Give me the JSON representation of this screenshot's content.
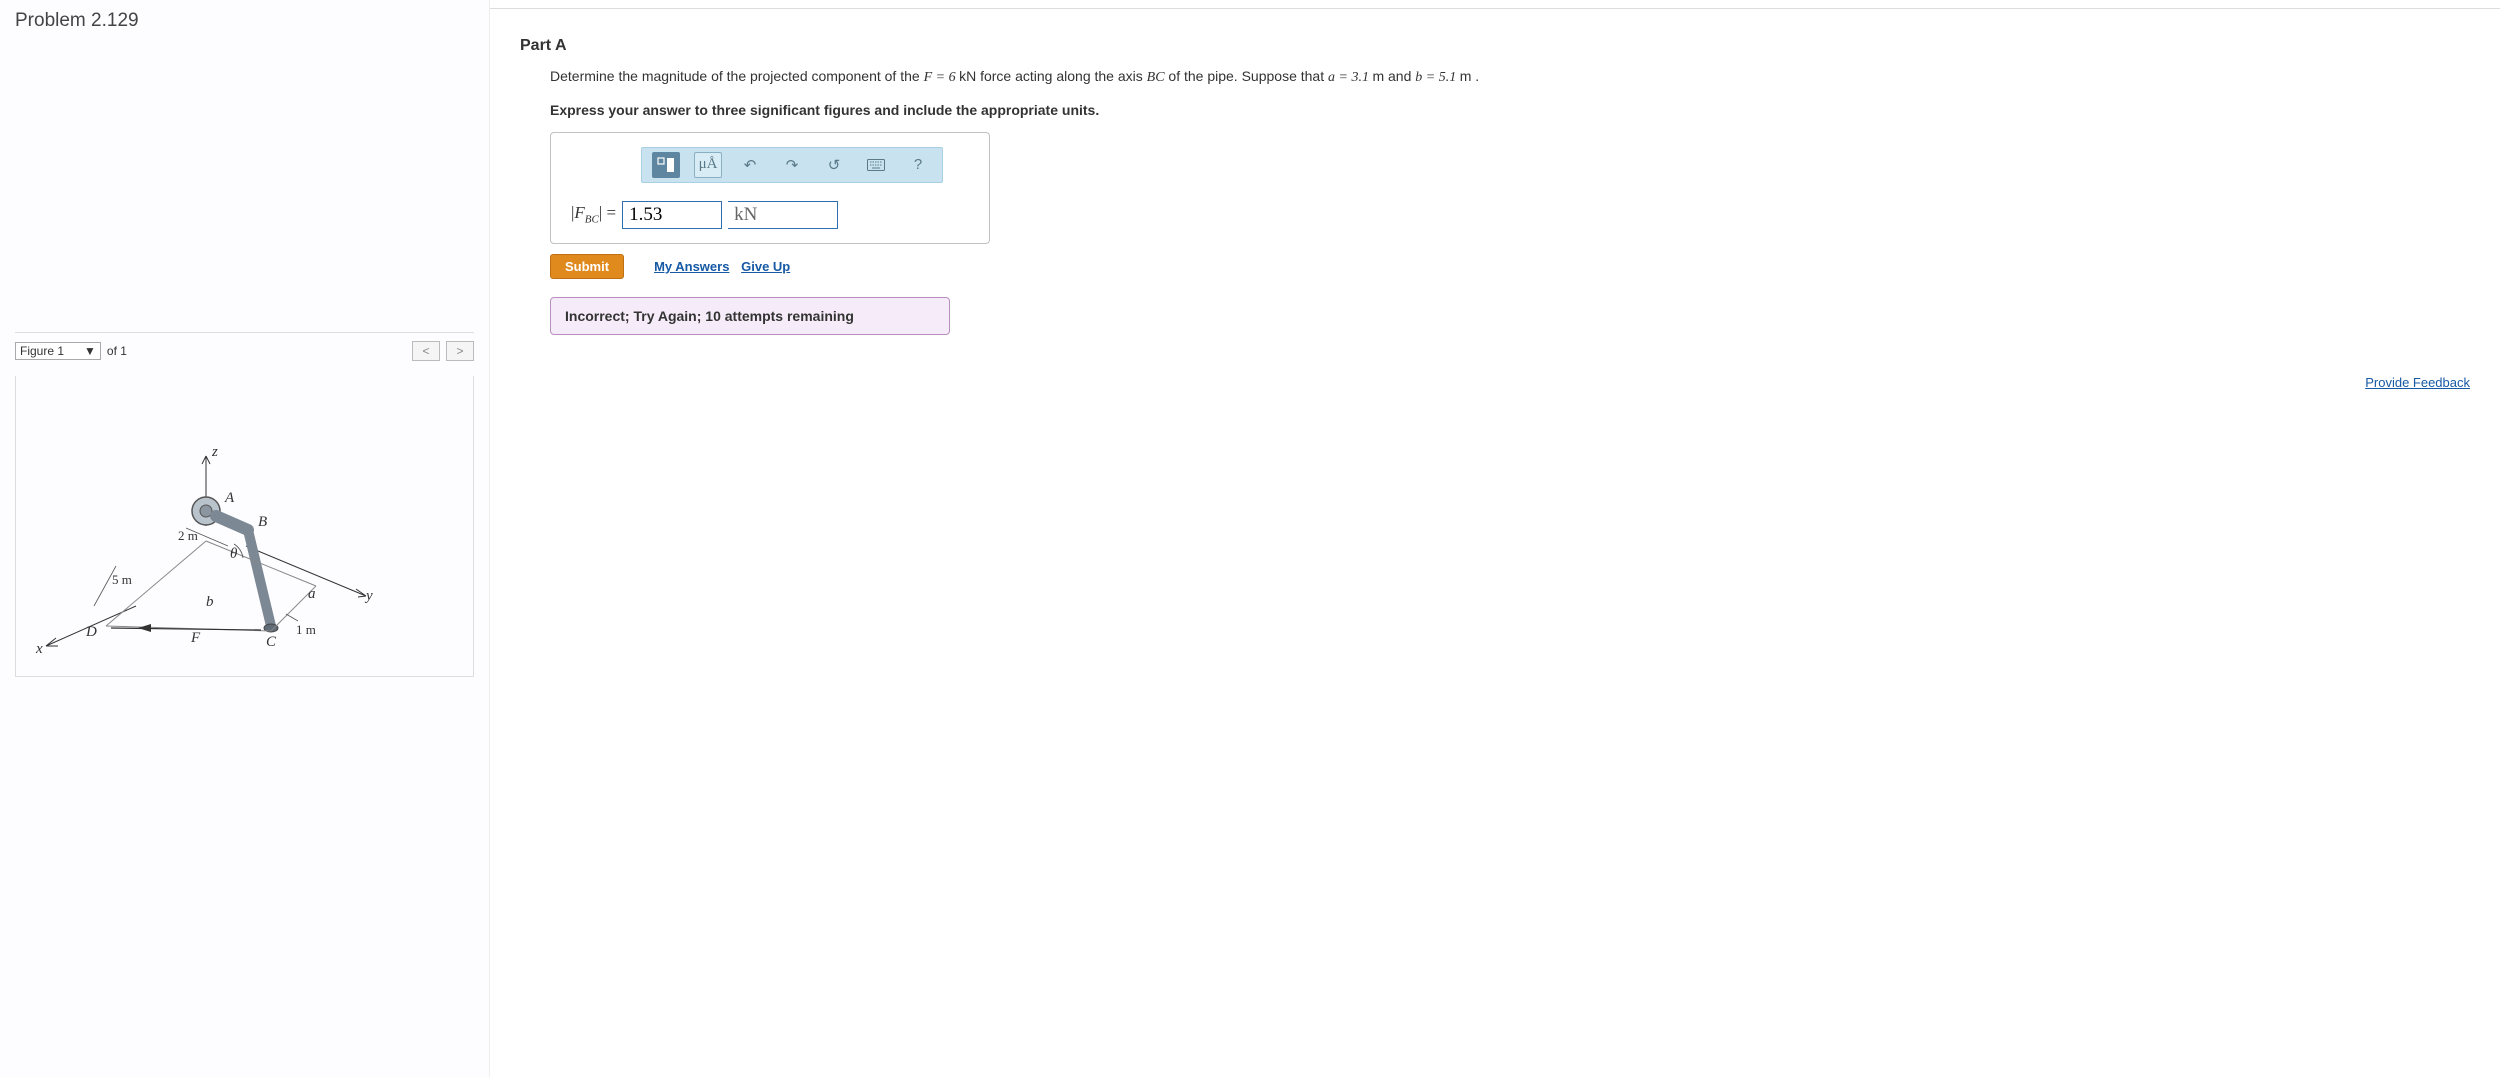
{
  "problem": {
    "title": "Problem 2.129"
  },
  "figure": {
    "selector_label": "Figure 1",
    "of_label": "of 1",
    "labels": {
      "z": "z",
      "y": "y",
      "x": "x",
      "A": "A",
      "B": "B",
      "C": "C",
      "D": "D",
      "F": "F",
      "theta": "θ",
      "a": "a",
      "b": "b"
    },
    "dims": {
      "two_m": "2 m",
      "five_m": "5 m",
      "one_m": "1 m"
    }
  },
  "part": {
    "heading": "Part A",
    "prompt_pre": "Determine the magnitude of the projected component of the ",
    "F_eq": "F = 6 ",
    "kN": "kN",
    "prompt_mid1": " force acting along the axis ",
    "BC": "BC",
    "prompt_mid2": " of the pipe. Suppose that ",
    "a_eq": "a = 3.1 ",
    "m1": "m",
    "and": " and ",
    "b_eq": "b = 5.1 ",
    "m2": "m",
    "period": " .",
    "instruction": "Express your answer to three significant figures and include the appropriate units."
  },
  "toolbar": {
    "template_icon": "template-icon",
    "units_label": "μÅ",
    "undo": "↶",
    "redo": "↷",
    "reset": "↺",
    "keyboard": "⌨",
    "help": "?"
  },
  "answer": {
    "var_open": "|",
    "var_F": "F",
    "var_sub": "BC",
    "var_close": "|",
    "equals": " = ",
    "value": "1.53",
    "unit": "kN"
  },
  "actions": {
    "submit": "Submit",
    "my_answers": "My Answers",
    "give_up": "Give Up"
  },
  "feedback": {
    "message": "Incorrect; Try Again; 10 attempts remaining"
  },
  "footer": {
    "provide_feedback": "Provide Feedback"
  }
}
